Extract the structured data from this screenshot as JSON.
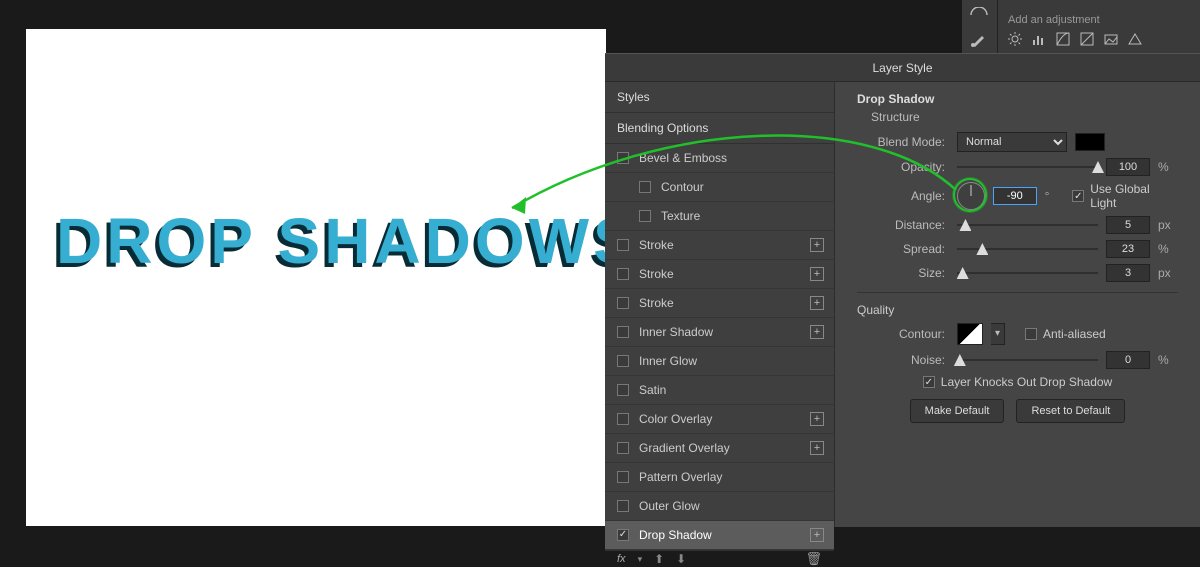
{
  "canvas": {
    "text": "DROP SHADOWS"
  },
  "adjustments": {
    "hint": "Add an adjustment",
    "icons": [
      "sun-icon",
      "levels-icon",
      "curves-icon",
      "exposure-icon",
      "photo-filter-icon",
      "triangle-icon"
    ]
  },
  "dialog": {
    "title": "Layer Style",
    "styles_header": "Styles",
    "blending_options": "Blending Options",
    "items": [
      {
        "label": "Bevel & Emboss",
        "checked": false
      },
      {
        "label": "Contour",
        "checked": false,
        "indent": true
      },
      {
        "label": "Texture",
        "checked": false,
        "indent": true
      },
      {
        "label": "Stroke",
        "checked": false,
        "plus": true
      },
      {
        "label": "Stroke",
        "checked": false,
        "plus": true
      },
      {
        "label": "Stroke",
        "checked": false,
        "plus": true
      },
      {
        "label": "Inner Shadow",
        "checked": false,
        "plus": true
      },
      {
        "label": "Inner Glow",
        "checked": false
      },
      {
        "label": "Satin",
        "checked": false
      },
      {
        "label": "Color Overlay",
        "checked": false,
        "plus": true
      },
      {
        "label": "Gradient Overlay",
        "checked": false,
        "plus": true
      },
      {
        "label": "Pattern Overlay",
        "checked": false
      },
      {
        "label": "Outer Glow",
        "checked": false
      },
      {
        "label": "Drop Shadow",
        "checked": true,
        "plus": true,
        "selected": true
      }
    ],
    "footer": {
      "fx": "fx"
    }
  },
  "settings": {
    "title": "Drop Shadow",
    "structure_label": "Structure",
    "blend_mode_label": "Blend Mode:",
    "blend_mode_value": "Normal",
    "opacity_label": "Opacity:",
    "opacity_value": "100",
    "opacity_unit": "%",
    "angle_label": "Angle:",
    "angle_value": "-90",
    "angle_unit": "°",
    "use_global_light": "Use Global Light",
    "distance_label": "Distance:",
    "distance_value": "5",
    "distance_unit": "px",
    "spread_label": "Spread:",
    "spread_value": "23",
    "spread_unit": "%",
    "size_label": "Size:",
    "size_value": "3",
    "size_unit": "px",
    "quality_label": "Quality",
    "contour_label": "Contour:",
    "antialiased_label": "Anti-aliased",
    "noise_label": "Noise:",
    "noise_value": "0",
    "noise_unit": "%",
    "knocks_out": "Layer Knocks Out Drop Shadow",
    "make_default": "Make Default",
    "reset_default": "Reset to Default"
  },
  "slider_positions": {
    "opacity": 100,
    "distance": 6,
    "spread": 18,
    "size": 4,
    "noise": 2
  }
}
